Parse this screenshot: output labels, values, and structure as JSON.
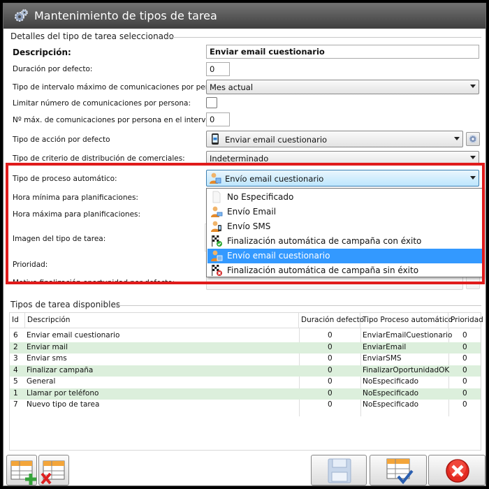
{
  "window": {
    "title": "Mantenimiento de tipos de tarea"
  },
  "details": {
    "section_title": "Detalles del tipo de tarea seleccionado",
    "descripcion_label": "Descripción:",
    "descripcion_value": "Enviar email cuestionario",
    "duracion_label": "Duración por defecto:",
    "duracion_value": "0",
    "intervalo_label": "Tipo de intervalo máximo de comunicaciones por persona:",
    "intervalo_value": "Mes actual",
    "limitar_label": "Limitar número de comunicaciones por persona:",
    "nmax_label": "Nº máx. de comunicaciones por persona en el intervalo:",
    "nmax_value": "0",
    "accion_label": "Tipo de acción por defecto",
    "accion_value": "Enviar email cuestionario",
    "criterio_label": "Tipo de criterio de distribución de comerciales:",
    "criterio_value": "Indeterminado",
    "proceso_label": "Tipo de proceso automático:",
    "proceso_value": "Envío email cuestionario",
    "hora_min_label": "Hora mínima para planificaciones:",
    "hora_max_label": "Hora máxima para planificaciones:",
    "imagen_label": "Imagen del tipo de tarea:",
    "prioridad_label": "Prioridad:",
    "motivo_label": "Motivo finalización oportunidad por defecto:"
  },
  "dropdown": {
    "items": [
      {
        "label": "No Especificado",
        "icon": "blank-document-icon",
        "selected": false
      },
      {
        "label": "Envío Email",
        "icon": "person-email-icon",
        "selected": false
      },
      {
        "label": "Envío SMS",
        "icon": "person-sms-icon",
        "selected": false
      },
      {
        "label": "Finalización automática de campaña con éxito",
        "icon": "checkered-flag-success-icon",
        "selected": false
      },
      {
        "label": "Envío email cuestionario",
        "icon": "person-questionnaire-icon",
        "selected": true
      },
      {
        "label": "Finalización automática de campaña sin éxito",
        "icon": "checkered-flag-failure-icon",
        "selected": false
      }
    ]
  },
  "table": {
    "section_title": "Tipos de tarea disponibles",
    "columns": [
      "Id",
      "Descripción",
      "Duración defecto",
      "Tipo Proceso automático",
      "Prioridad"
    ],
    "rows": [
      {
        "id": "6",
        "descripcion": "Enviar email cuestionario",
        "duracion": "0",
        "proceso": "EnviarEmailCuestionario",
        "prioridad": "0"
      },
      {
        "id": "2",
        "descripcion": "Enviar mail",
        "duracion": "0",
        "proceso": "EnviarEmail",
        "prioridad": "0"
      },
      {
        "id": "3",
        "descripcion": "Enviar sms",
        "duracion": "0",
        "proceso": "EnviarSMS",
        "prioridad": "0"
      },
      {
        "id": "4",
        "descripcion": "Finalizar campaña",
        "duracion": "0",
        "proceso": "FinalizarOportunidadOK",
        "prioridad": "0"
      },
      {
        "id": "5",
        "descripcion": "General",
        "duracion": "0",
        "proceso": "NoEspecificado",
        "prioridad": "0"
      },
      {
        "id": "1",
        "descripcion": "Llamar por teléfono",
        "duracion": "0",
        "proceso": "NoEspecificado",
        "prioridad": "0"
      },
      {
        "id": "7",
        "descripcion": "Nuevo tipo de tarea",
        "duracion": "0",
        "proceso": "NoEspecificado",
        "prioridad": "0"
      }
    ]
  },
  "toolbar": {
    "add_icon": "grid-add-icon",
    "delete_icon": "grid-delete-icon",
    "save_icon": "floppy-disk-icon",
    "accept_icon": "grid-check-icon",
    "close_icon": "red-x-close-icon"
  },
  "colors": {
    "highlight_frame": "#e01b1b",
    "selected_item": "#3399ff",
    "alt_row": "#dcefdc",
    "title_bar": "#4a4a4a"
  }
}
